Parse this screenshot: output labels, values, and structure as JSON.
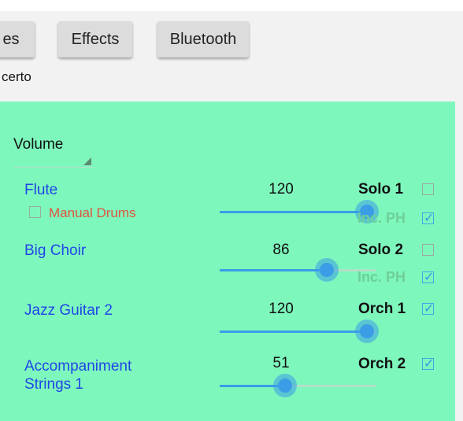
{
  "tabs": [
    {
      "label": "es"
    },
    {
      "label": "Effects"
    },
    {
      "label": "Bluetooth"
    }
  ],
  "subtitle": "certo",
  "volume_dropdown": {
    "selected": "Volume"
  },
  "rows": [
    {
      "instrument": "Flute",
      "value": "120",
      "level": 120,
      "role": "Solo 1",
      "role_checked": false,
      "incph": "Inc. PH",
      "incph_checked": true
    },
    {
      "instrument": "Big Choir",
      "value": "86",
      "level": 86,
      "role": "Solo 2",
      "role_checked": false,
      "incph": "Inc. PH",
      "incph_checked": true
    },
    {
      "instrument": "Jazz Guitar 2",
      "value": "120",
      "level": 120,
      "role": "Orch 1",
      "role_checked": true
    },
    {
      "instrument": "Accompaniment\nStrings 1",
      "value": "51",
      "level": 51,
      "role": "Orch 2",
      "role_checked": true
    }
  ],
  "manual_drums": {
    "label": "Manual Drums",
    "checked": false
  },
  "colors": {
    "panel": "#7ef7bd",
    "instrument_text": "#1f46e6",
    "slider": "#3b9de6",
    "manual_drums": "#e0543e",
    "incph": "#6ecf98"
  },
  "icons": {
    "checkbox_checked": "check-icon",
    "dropdown": "dropdown-triangle-icon"
  }
}
